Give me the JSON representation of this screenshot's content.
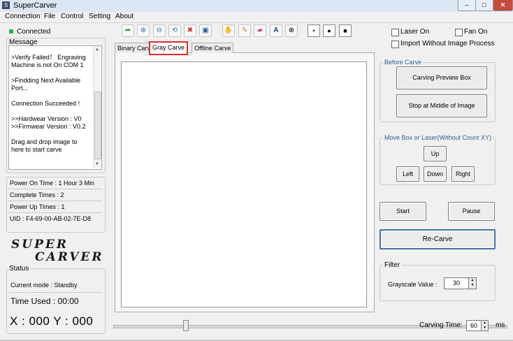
{
  "window": {
    "title": "SuperCarver",
    "icon_letter": "S",
    "minimize": "–",
    "maximize": "□",
    "close": "✕"
  },
  "menu": [
    "Connection",
    "File",
    "Control",
    "Setting",
    "About"
  ],
  "connection": {
    "status": "Connected",
    "status_color": "#2fb34a"
  },
  "message": {
    "label": "Message",
    "lines": [
      ">Verify Failed！ Engraving Machine is not On COM 1",
      ">Findding Next Available Port...",
      "Connection Succeeded !",
      ">>Hardwear Version : V0\n>>Firmwear Version : V0.2",
      "Drag and drop image to here to start carve"
    ]
  },
  "info": {
    "power_on_time": "Power On Time : 1 Hour 3 Min",
    "complete_times": "Complete Times : 2",
    "power_up_times": "Power Up Times : 1",
    "uid": "UID : F4-69-00-AB-02-7E-D8"
  },
  "logo": {
    "line1": "SUPER",
    "line2": "CARVER"
  },
  "status": {
    "label": "Status",
    "current_mode": "Current mode : Standby",
    "time_used": "Time Used :   00:00",
    "coords": "X : 000  Y : 000"
  },
  "toolbar": {
    "icons": [
      "open-folder-icon",
      "zoom-in-icon",
      "zoom-out-icon",
      "rotate-icon",
      "delete-image-icon",
      "save-icon",
      "hand-icon",
      "pencil-icon",
      "eraser-icon",
      "text-icon",
      "crosshair-icon"
    ],
    "size_small": "•",
    "size_medium": "●",
    "size_large": "■"
  },
  "options": {
    "laser_on": "Laser On",
    "fan_on": "Fan On",
    "import_without": "Import Without  Image Process"
  },
  "tabs": [
    "Binary Carve",
    "Gray Carve",
    "Offline Carve"
  ],
  "before_carve": {
    "label": "Before Carve",
    "preview_box": "Carving Preview Box",
    "stop_middle": "Stop at Middle of Image"
  },
  "move_box": {
    "label": "Move Box or Laser(Without Count XY)",
    "up": "Up",
    "left": "Left",
    "down": "Down",
    "right": "Right"
  },
  "controls": {
    "start": "Start",
    "pause": "Pause",
    "recarve": "Re-Carve"
  },
  "filter": {
    "label": "Filter",
    "grayscale_label": "Grayscale Value :",
    "grayscale_value": "30"
  },
  "carving_time": {
    "label": "Carving Time:",
    "value": "60",
    "unit": "ms"
  }
}
